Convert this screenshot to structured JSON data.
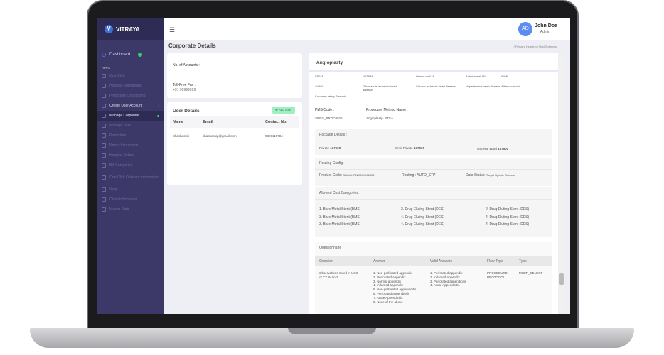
{
  "brand": "VITRAYA",
  "sidebar": {
    "dashboard": "Dashboard",
    "section": "APPS",
    "items": [
      {
        "label": "One Click",
        "arrow": true
      },
      {
        "label": "Hospital Onboarding"
      },
      {
        "label": "Procedure Onboarding"
      },
      {
        "label": "Create User Account",
        "arrow": true,
        "bright": true
      },
      {
        "label": "Manage Corporate",
        "active": true
      },
      {
        "label": "Manage User"
      },
      {
        "label": "Procedure",
        "arrow": true
      },
      {
        "label": "Illness Information"
      },
      {
        "label": "Hospital Details",
        "arrow": true
      },
      {
        "label": "Bill Categories",
        "arrow": true
      },
      {
        "label": "One Click Onboard Information"
      },
      {
        "label": "Vpay",
        "arrow": true
      },
      {
        "label": "Claim Information"
      },
      {
        "label": "Master Data",
        "arrow": true
      }
    ]
  },
  "header": {
    "avatar": "AD",
    "name": "John Doe",
    "role": "Admin"
  },
  "page": {
    "title": "Corporate Details",
    "breadcrumb": "/ Primary Heading / First Submenu"
  },
  "corporate": {
    "accounts_label": "No. of Accounts :",
    "fax_label": "Toll-Free Fax :",
    "fax_value": "+91 99999999"
  },
  "users": {
    "title": "User Details",
    "add": "Add User",
    "cols": [
      "Name",
      "Email",
      "Contact No."
    ],
    "rows": [
      [
        "Shashaskip",
        "shashaskip@gmail.com",
        "9826119784"
      ]
    ]
  },
  "procedure": {
    "title": "Angioplasty",
    "conditions": [
      "STEMI",
      "NSTEMI",
      "Inferior wall MI",
      "Anterior wall MI",
      "IWMI",
      "AWMI",
      "Other acute ischemic heart disease",
      "Chronic ischemic heart disease",
      "Hypertensive heart disease",
      "Atherosclerosis",
      "Coronary artery Stenosis"
    ],
    "pms_label": "PMS Code :",
    "pms_value": "SURG_PROC0925",
    "method_label": "Procedure Method Name :",
    "method_value": "Angioplasty- PTCA"
  },
  "package": {
    "title": "Package Details :",
    "private_label": "Private",
    "private": "137500",
    "semi_label": "Semi-Private",
    "semi": "137500",
    "general_label": "General Ward",
    "general": "137500"
  },
  "routing": {
    "title": "Routing Config:",
    "product_label": "Product Code:",
    "product": "SHAHLIP22030V062122",
    "routing": "Routing : AUTO_STP",
    "status_label": "Data Status:",
    "status": "Target Update Success"
  },
  "cost": {
    "title": "Allowed Cost Categories:",
    "items": [
      "1. Bare Metal Stent (BMS)",
      "2. Drug Eluting Stent (DES)",
      "2. Drug Eluting Stent (DES)",
      "3. Bare Metal Stent (BMS)",
      "4. Drug Eluting Stent (DES)",
      "4. Drug Eluting Stent (DES)",
      "3. Bare Metal Stent (BMS)",
      "4. Drug Eluting Stent (DES)",
      "4. Drug Eluting Stent (DES)"
    ]
  },
  "questionnaire": {
    "title": "Questionnaire",
    "cols": [
      "Question",
      "Answer",
      "Valid Answers",
      "Flow Type",
      "Type"
    ],
    "question": "Observations noted in USG or CT Scan ?",
    "answers": [
      "1. Non-perforated appendix",
      "2. Perforated appendix",
      "3. Normal appendix",
      "4. Inflamed appendix",
      "5. Non-perforated appendicitis",
      "6. Perforated appendicitis",
      "7. Acute Appendicitis",
      "8. None of the above"
    ],
    "valid": [
      "1. Perforated appendix",
      "2. Inflamed appendix",
      "3. Perforated appendicitis",
      "4. Acute Appendicitis"
    ],
    "flow": "PROCEDURE PROTOCOL",
    "type": "MULTI_SELECT"
  }
}
